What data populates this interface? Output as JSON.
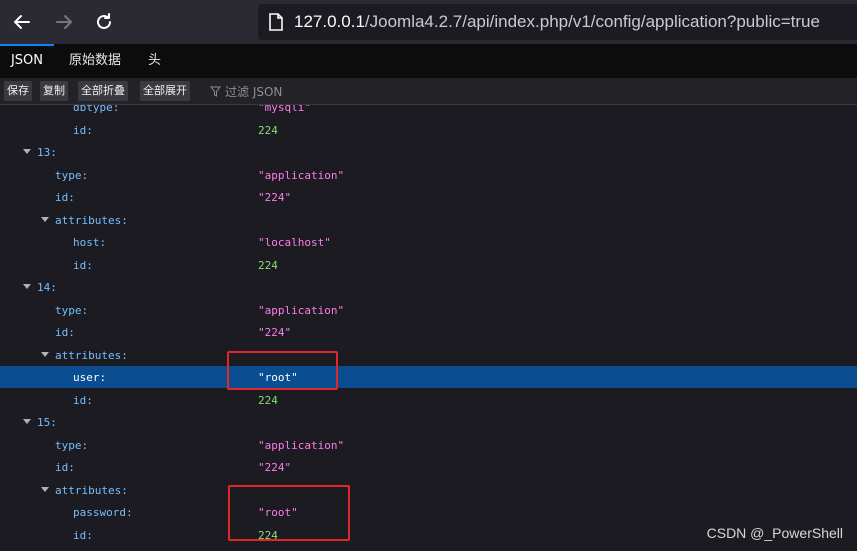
{
  "browser": {
    "url_host": "127.0.0.1",
    "url_path": "/Joomla4.2.7/api/index.php/v1/config/application?public=true"
  },
  "tabs": [
    {
      "label": "JSON",
      "active": true
    },
    {
      "label": "原始数据",
      "active": false
    },
    {
      "label": "头",
      "active": false
    }
  ],
  "toolbar": {
    "save": "保存",
    "copy": "复制",
    "collapse_all": "全部折叠",
    "expand_all": "全部展开",
    "filter_placeholder": "过滤 JSON"
  },
  "tree_rows": [
    {
      "key": "dbtype:",
      "value": "\"mysqli\"",
      "vtype": "str"
    },
    {
      "key": "id:",
      "value": "224",
      "vtype": "num"
    },
    {
      "key": "13:",
      "value": "",
      "vtype": "",
      "expandable": true
    },
    {
      "key": "type:",
      "value": "\"application\"",
      "vtype": "str"
    },
    {
      "key": "id:",
      "value": "\"224\"",
      "vtype": "str"
    },
    {
      "key": "attributes:",
      "value": "",
      "vtype": "",
      "expandable": true
    },
    {
      "key": "host:",
      "value": "\"localhost\"",
      "vtype": "str"
    },
    {
      "key": "id:",
      "value": "224",
      "vtype": "num"
    },
    {
      "key": "14:",
      "value": "",
      "vtype": "",
      "expandable": true
    },
    {
      "key": "type:",
      "value": "\"application\"",
      "vtype": "str"
    },
    {
      "key": "id:",
      "value": "\"224\"",
      "vtype": "str"
    },
    {
      "key": "attributes:",
      "value": "",
      "vtype": "",
      "expandable": true
    },
    {
      "key": "user:",
      "value": "\"root\"",
      "vtype": "str",
      "selected": true
    },
    {
      "key": "id:",
      "value": "224",
      "vtype": "num"
    },
    {
      "key": "15:",
      "value": "",
      "vtype": "",
      "expandable": true
    },
    {
      "key": "type:",
      "value": "\"application\"",
      "vtype": "str"
    },
    {
      "key": "id:",
      "value": "\"224\"",
      "vtype": "str"
    },
    {
      "key": "attributes:",
      "value": "",
      "vtype": "",
      "expandable": true
    },
    {
      "key": "password:",
      "value": "\"root\"",
      "vtype": "str"
    },
    {
      "key": "id:",
      "value": "224",
      "vtype": "num"
    }
  ],
  "watermark": "CSDN @_PowerShell"
}
